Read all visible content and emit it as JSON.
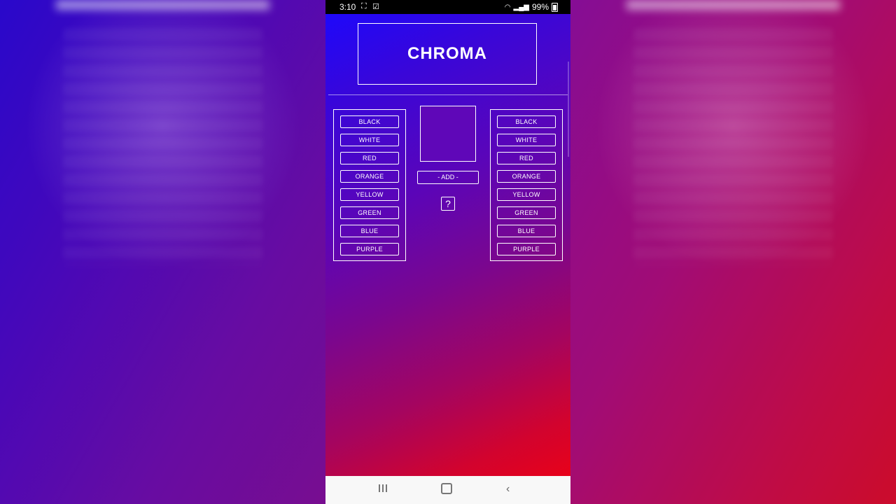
{
  "statusbar": {
    "time": "3:10",
    "battery": "99%",
    "icons": [
      "screenshot-icon",
      "check-icon",
      "wifi-icon",
      "signal-icon",
      "battery-icon"
    ]
  },
  "app": {
    "title": "CHROMA",
    "add_label": "- ADD -",
    "help_label": "?"
  },
  "left_palette": [
    "BLACK",
    "WHITE",
    "RED",
    "ORANGE",
    "YELLOW",
    "GREEN",
    "BLUE",
    "PURPLE"
  ],
  "right_palette": [
    "BLACK",
    "WHITE",
    "RED",
    "ORANGE",
    "YELLOW",
    "GREEN",
    "BLUE",
    "PURPLE"
  ],
  "colors": {
    "preview": "#5f07b8",
    "gradient_start": "#1a08ff",
    "gradient_end": "#f20010"
  },
  "navbar": {
    "icons": [
      "recents-icon",
      "home-icon",
      "back-icon"
    ]
  }
}
